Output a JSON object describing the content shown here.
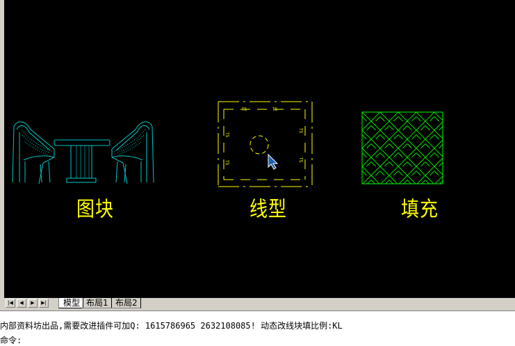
{
  "drawing": {
    "captions": {
      "block": "图块",
      "linetype": "线型",
      "hatch": "填充"
    },
    "linetype_marks": {
      "top_left": "T5",
      "top_right": "T5",
      "left_top": "T5",
      "left_bottom": "T5",
      "right_top": "T5",
      "right_bottom": "T5"
    },
    "colors": {
      "background": "#000000",
      "caption": "#ffff00",
      "furniture": "#00c8c8",
      "linetype": "#ffff00",
      "hatch": "#00ff00",
      "cursor": "#1e5fb4"
    }
  },
  "layout_tabs": {
    "nav": [
      "first-icon",
      "prev-icon",
      "next-icon",
      "last-icon"
    ],
    "tabs": [
      {
        "label": "模型",
        "active": true
      },
      {
        "label": "布局1",
        "active": false
      },
      {
        "label": "布局2",
        "active": false
      }
    ]
  },
  "command": {
    "history": "内部资料坊出品,需要改进插件可加Q: 1615786965 2632108085! 动态改线块填比例:KL",
    "prompt": "命令:"
  }
}
